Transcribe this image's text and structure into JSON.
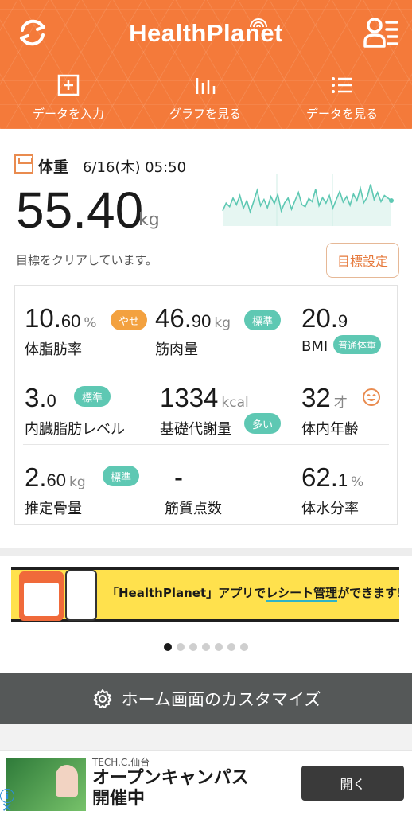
{
  "colors": {
    "accent": "#f47a3a",
    "badge_orange": "#f3a13f",
    "badge_teal": "#5ec8b3",
    "chart_line": "#5ec8b3"
  },
  "header": {
    "brand": "HealthPlanet",
    "left_icon": "sync-icon",
    "right_icon": "user-menu-icon",
    "nav": [
      {
        "label": "データを入力",
        "icon": "plus-square-icon"
      },
      {
        "label": "グラフを見る",
        "icon": "bar-graph-icon"
      },
      {
        "label": "データを見る",
        "icon": "list-icon"
      }
    ]
  },
  "weight": {
    "title": "体重",
    "date": "6/16(木) 05:50",
    "value": "55.40",
    "unit": "kg",
    "goal_message": "目標をクリアしています。",
    "goal_button": "目標設定"
  },
  "metrics": [
    {
      "value": "10.",
      "decimal": "60",
      "unit": "%",
      "label": "体脂肪率",
      "badge": "やせ",
      "badge_color": "orange"
    },
    {
      "value": "46.",
      "decimal": "90",
      "unit": "kg",
      "label": "筋肉量",
      "badge": "標準",
      "badge_color": "teal"
    },
    {
      "value": "20.",
      "decimal": "9",
      "unit": "",
      "label": "BMI",
      "badge": "普通体重",
      "badge_color": "teal"
    },
    {
      "value": "3.",
      "decimal": "0",
      "unit": "",
      "label": "内臓脂肪レベル",
      "badge": "標準",
      "badge_color": "teal"
    },
    {
      "value": "1334",
      "decimal": "",
      "unit": "kcal",
      "label": "基礎代謝量",
      "badge": "多い",
      "badge_color": "teal"
    },
    {
      "value": "32",
      "decimal": "",
      "unit": "才",
      "label": "体内年齢",
      "badge": "",
      "icon": "smiley-face-icon"
    },
    {
      "value": "2.",
      "decimal": "60",
      "unit": "kg",
      "label": "推定骨量",
      "badge": "標準",
      "badge_color": "teal"
    },
    {
      "value": "-",
      "decimal": "",
      "unit": "",
      "label": "筋質点数",
      "badge": ""
    },
    {
      "value": "62.",
      "decimal": "1",
      "unit": "%",
      "label": "体水分率",
      "badge": ""
    }
  ],
  "banner": {
    "text_prefix": "「HealthPlanet」アプリで",
    "text_highlight": "レシート管理",
    "text_suffix": "ができます!",
    "page_count": 7,
    "active_index": 0
  },
  "customize": {
    "label": "ホーム画面のカスタマイズ",
    "icon": "gear-icon"
  },
  "ad": {
    "sponsor": "TECH.C.仙台",
    "title_line1": "オープンキャンパス",
    "title_line2": "開催中",
    "button": "開く",
    "info_icon": "info-icon",
    "close_icon": "close-icon"
  },
  "sparkline": [
    0.3,
    0.45,
    0.38,
    0.55,
    0.42,
    0.6,
    0.35,
    0.5,
    0.28,
    0.48,
    0.7,
    0.4,
    0.52,
    0.36,
    0.58,
    0.44,
    0.62,
    0.3,
    0.46,
    0.55,
    0.33,
    0.5,
    0.66,
    0.42,
    0.38,
    0.54,
    0.48,
    0.72,
    0.4,
    0.56,
    0.45,
    0.6,
    0.35,
    0.52,
    0.68,
    0.47,
    0.58,
    0.41,
    0.63,
    0.5,
    0.74,
    0.46,
    0.57,
    0.82,
    0.52,
    0.66,
    0.48,
    0.6,
    0.55,
    0.5
  ]
}
